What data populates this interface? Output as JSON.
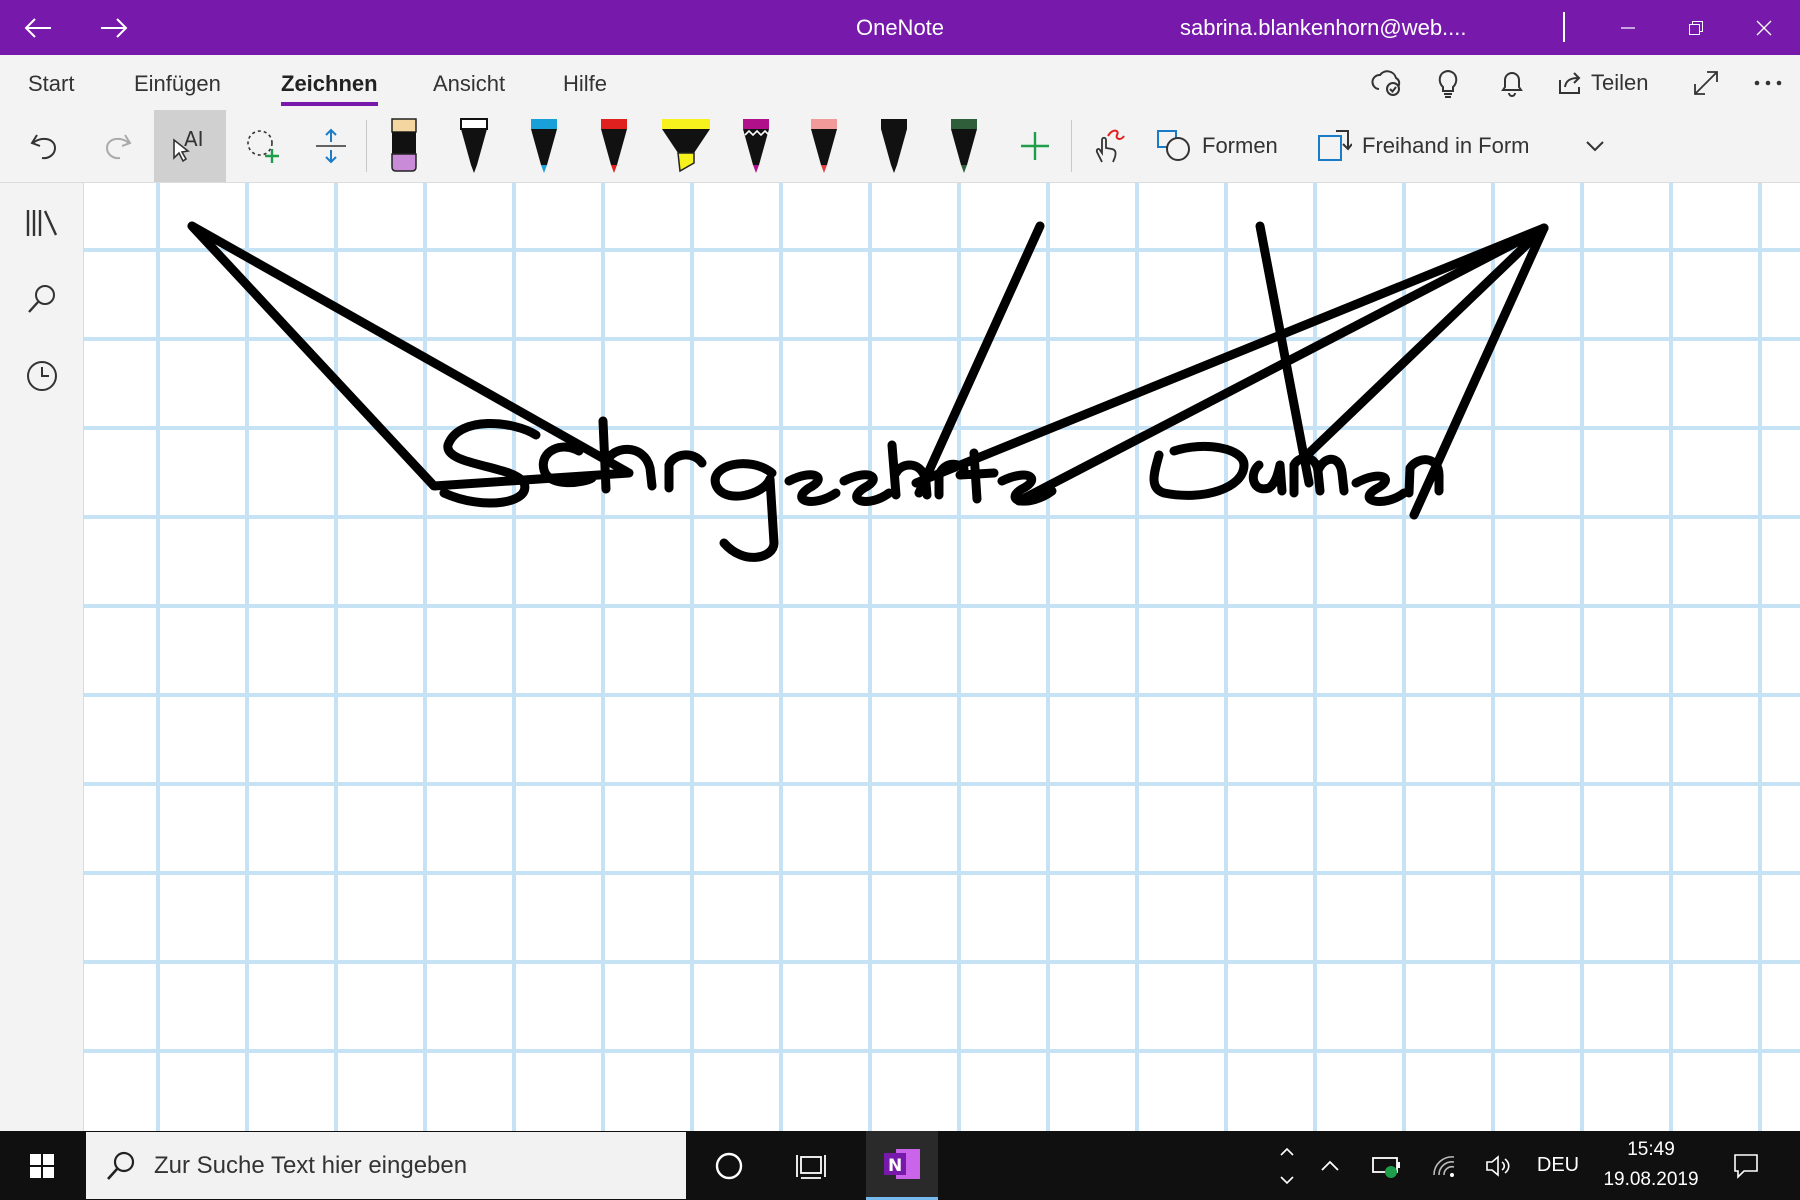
{
  "app": {
    "title": "OneNote",
    "account": "sabrina.blankenhorn@web....",
    "brand_color": "#7719AA"
  },
  "titlebar": {
    "icons": [
      "back-arrow-icon",
      "forward-arrow-icon",
      "minimize-icon",
      "restore-icon",
      "close-icon"
    ]
  },
  "ribbon": {
    "tabs": [
      {
        "label": "Start"
      },
      {
        "label": "Einfügen"
      },
      {
        "label": "Zeichnen",
        "active": true
      },
      {
        "label": "Ansicht"
      },
      {
        "label": "Hilfe"
      }
    ],
    "share_label": "Teilen",
    "right_icons": [
      "sync-status-icon",
      "lightbulb-icon",
      "bell-icon",
      "share-icon",
      "fullscreen-icon",
      "more-icon"
    ]
  },
  "toolbar": {
    "shapes_label": "Formen",
    "ink_to_shape_label": "Freihand in Form",
    "pens": [
      {
        "name": "highlighter-lilac",
        "color": "#C98BD8",
        "cap": "#F4D7A0"
      },
      {
        "name": "pen-black",
        "color": "#111111"
      },
      {
        "name": "pen-cyan",
        "color": "#1AA0D8"
      },
      {
        "name": "pen-red",
        "color": "#E0201E"
      },
      {
        "name": "highlighter-yellow",
        "color": "#F7F21E"
      },
      {
        "name": "pen-magenta-galaxy",
        "color": "#B0108A"
      },
      {
        "name": "pen-pink",
        "color": "#F29A9A"
      },
      {
        "name": "pen-black-2",
        "color": "#111111"
      },
      {
        "name": "pen-darkgreen",
        "color": "#2F5E3A"
      }
    ]
  },
  "leftnav": {
    "icons": [
      "notebooks-icon",
      "search-icon",
      "recent-icon"
    ]
  },
  "taskbar": {
    "search_placeholder": "Zur Suche Text hier eingeben",
    "language": "DEU",
    "time": "15:49",
    "date": "19.08.2019"
  }
}
